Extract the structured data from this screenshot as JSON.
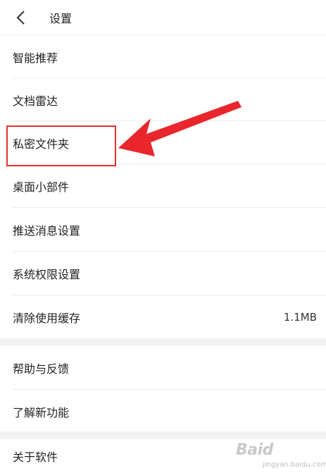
{
  "header": {
    "title": "设置",
    "back_icon": "chevron-left-icon"
  },
  "settings": [
    {
      "label": "智能推荐",
      "value": ""
    },
    {
      "label": "文档雷达",
      "value": ""
    },
    {
      "label": "私密文件夹",
      "value": ""
    },
    {
      "label": "桌面小部件",
      "value": ""
    },
    {
      "label": "推送消息设置",
      "value": ""
    },
    {
      "label": "系统权限设置",
      "value": ""
    },
    {
      "label": "清除使用缓存",
      "value": "1.1MB"
    },
    {
      "label": "帮助与反馈",
      "value": ""
    },
    {
      "label": "了解新功能",
      "value": ""
    },
    {
      "label": "关于软件",
      "value": ""
    }
  ],
  "annotation": {
    "highlight_color": "#e3312d",
    "arrow_color": "#e8262b"
  },
  "watermark": {
    "main": "Baid",
    "sub": "jingyan.baidu.com"
  }
}
